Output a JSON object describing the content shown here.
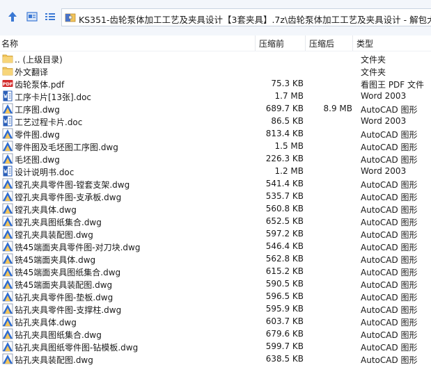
{
  "address": {
    "path": "KS351-齿轮泵体加工工艺及夹具设计【3套夹具】.7z\\齿轮泵体加工工艺及夹具设计 - 解包大小为"
  },
  "columns": {
    "name": "名称",
    "before": "压缩前",
    "after": "压缩后",
    "type": "类型"
  },
  "icons": {
    "up": "up-arrow-icon",
    "view_details": "details-view-icon",
    "view_list": "list-view-icon",
    "archive": "archive-icon",
    "folder": "folder-icon",
    "pdf": "pdf-icon",
    "word": "word-doc-icon",
    "autocad": "autocad-dwg-icon"
  },
  "colors": {
    "folder": "#f2c55c",
    "pdf_red": "#d32b2b",
    "word_blue": "#2b5fb8",
    "autocad_blue": "#2d6bd1"
  },
  "files": [
    {
      "name": ".. (上级目录)",
      "before": "",
      "after": "",
      "type": "文件夹",
      "kind": "folder"
    },
    {
      "name": "外文翻译",
      "before": "",
      "after": "",
      "type": "文件夹",
      "kind": "folder"
    },
    {
      "name": "齿轮泵体.pdf",
      "before": "75.3 KB",
      "after": "",
      "type": "看图王 PDF 文件",
      "kind": "pdf"
    },
    {
      "name": "工序卡片[13张].doc",
      "before": "1.7 MB",
      "after": "",
      "type": "Word 2003",
      "kind": "word"
    },
    {
      "name": "工序图.dwg",
      "before": "689.7 KB",
      "after": "8.9 MB",
      "type": "AutoCAD 图形",
      "kind": "dwg"
    },
    {
      "name": "工艺过程卡片.doc",
      "before": "86.5 KB",
      "after": "",
      "type": "Word 2003",
      "kind": "word"
    },
    {
      "name": "零件图.dwg",
      "before": "813.4 KB",
      "after": "",
      "type": "AutoCAD 图形",
      "kind": "dwg"
    },
    {
      "name": "零件图及毛坯图工序图.dwg",
      "before": "1.5 MB",
      "after": "",
      "type": "AutoCAD 图形",
      "kind": "dwg"
    },
    {
      "name": "毛坯图.dwg",
      "before": "226.3 KB",
      "after": "",
      "type": "AutoCAD 图形",
      "kind": "dwg"
    },
    {
      "name": "设计说明书.doc",
      "before": "1.2 MB",
      "after": "",
      "type": "Word 2003",
      "kind": "word"
    },
    {
      "name": "镗孔夹具零件图-镗套支架.dwg",
      "before": "541.4 KB",
      "after": "",
      "type": "AutoCAD 图形",
      "kind": "dwg"
    },
    {
      "name": "镗孔夹具零件图-支承板.dwg",
      "before": "535.7 KB",
      "after": "",
      "type": "AutoCAD 图形",
      "kind": "dwg"
    },
    {
      "name": "镗孔夹具体.dwg",
      "before": "560.8 KB",
      "after": "",
      "type": "AutoCAD 图形",
      "kind": "dwg"
    },
    {
      "name": "镗孔夹具图纸集合.dwg",
      "before": "652.5 KB",
      "after": "",
      "type": "AutoCAD 图形",
      "kind": "dwg"
    },
    {
      "name": "镗孔夹具装配图.dwg",
      "before": "597.2 KB",
      "after": "",
      "type": "AutoCAD 图形",
      "kind": "dwg"
    },
    {
      "name": "铣45端面夹具零件图-对刀块.dwg",
      "before": "546.4 KB",
      "after": "",
      "type": "AutoCAD 图形",
      "kind": "dwg"
    },
    {
      "name": "铣45端面夹具体.dwg",
      "before": "562.8 KB",
      "after": "",
      "type": "AutoCAD 图形",
      "kind": "dwg"
    },
    {
      "name": "铣45端面夹具图纸集合.dwg",
      "before": "615.2 KB",
      "after": "",
      "type": "AutoCAD 图形",
      "kind": "dwg"
    },
    {
      "name": "铣45端面夹具装配图.dwg",
      "before": "590.5 KB",
      "after": "",
      "type": "AutoCAD 图形",
      "kind": "dwg"
    },
    {
      "name": "钻孔夹具零件图-垫板.dwg",
      "before": "596.5 KB",
      "after": "",
      "type": "AutoCAD 图形",
      "kind": "dwg"
    },
    {
      "name": "钻孔夹具零件图-支撑柱.dwg",
      "before": "595.9 KB",
      "after": "",
      "type": "AutoCAD 图形",
      "kind": "dwg"
    },
    {
      "name": "钻孔夹具体.dwg",
      "before": "603.7 KB",
      "after": "",
      "type": "AutoCAD 图形",
      "kind": "dwg"
    },
    {
      "name": "钻孔夹具图纸集合.dwg",
      "before": "679.6 KB",
      "after": "",
      "type": "AutoCAD 图形",
      "kind": "dwg"
    },
    {
      "name": "钻孔夹具图纸零件图-钻模板.dwg",
      "before": "599.7 KB",
      "after": "",
      "type": "AutoCAD 图形",
      "kind": "dwg"
    },
    {
      "name": "钻孔夹具装配图.dwg",
      "before": "638.5 KB",
      "after": "",
      "type": "AutoCAD 图形",
      "kind": "dwg"
    }
  ]
}
